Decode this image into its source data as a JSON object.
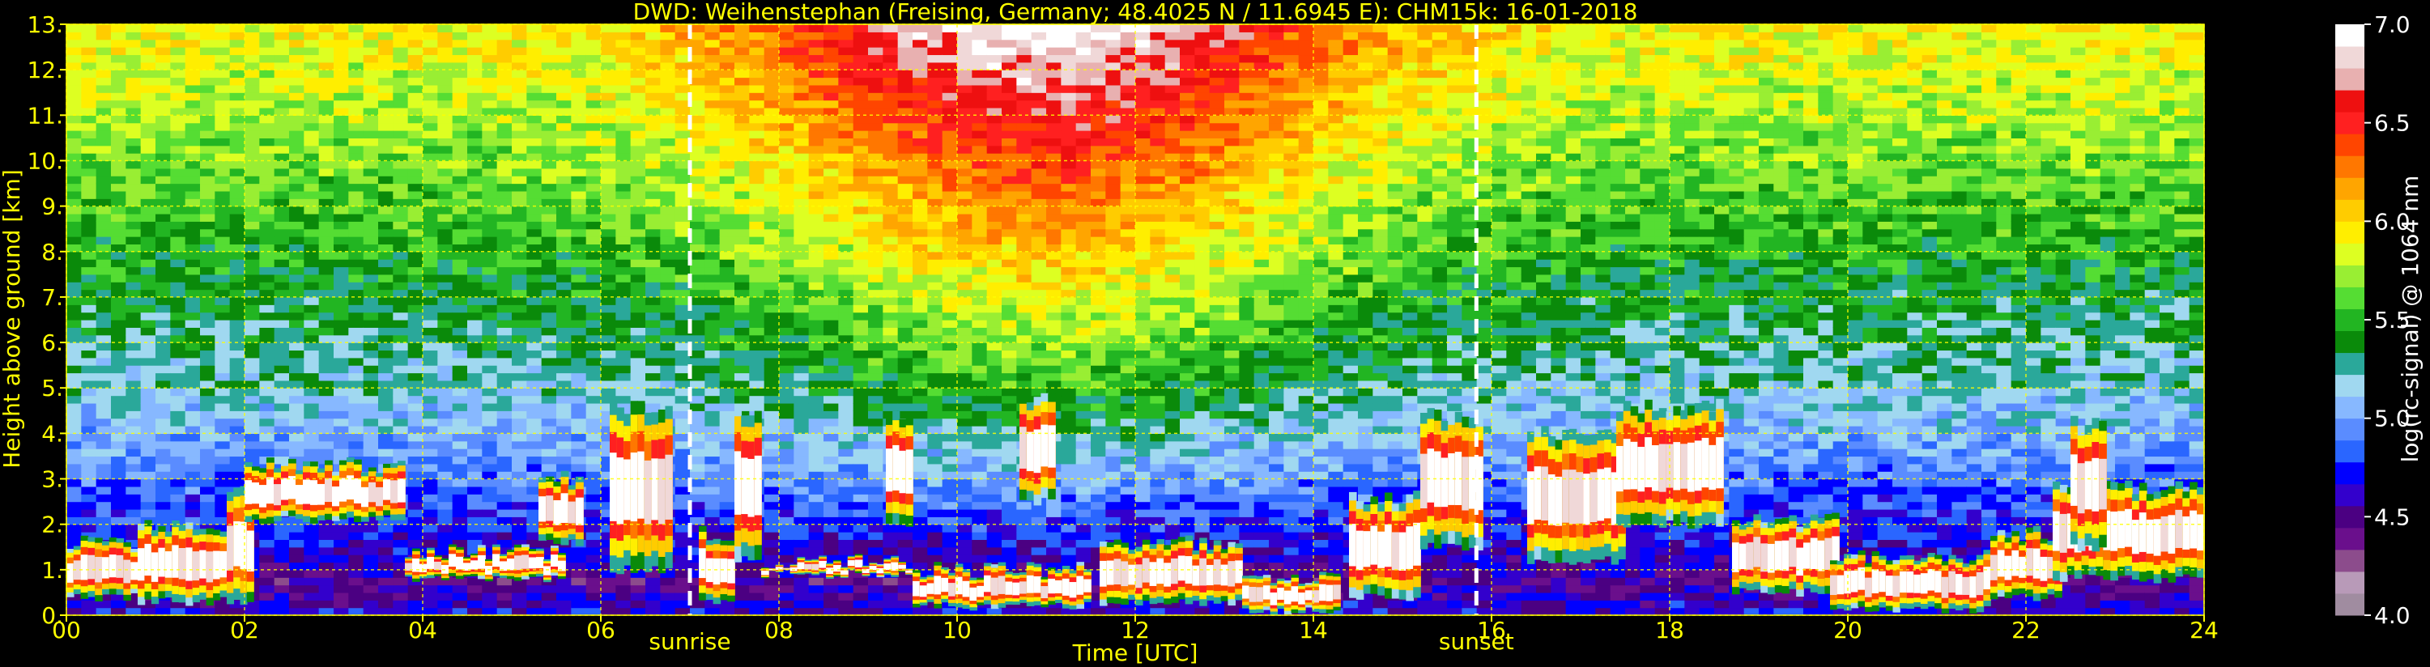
{
  "chart_data": {
    "type": "heatmap",
    "title": "DWD: Weihenstephan (Freising, Germany; 48.4025 N / 11.6945 E):    CHM15k: 16-01-2018",
    "xlabel": "Time [UTC]",
    "ylabel": "Height above ground [km]",
    "xlim": [
      0,
      24
    ],
    "ylim": [
      0,
      13
    ],
    "x_ticks": [
      0,
      2,
      4,
      6,
      8,
      10,
      12,
      14,
      16,
      18,
      20,
      22,
      24
    ],
    "x_tick_labels": [
      "00",
      "02",
      "04",
      "06",
      "08",
      "10",
      "12",
      "14",
      "16",
      "18",
      "20",
      "22",
      "24"
    ],
    "y_ticks": [
      0,
      1,
      2,
      3,
      4,
      5,
      6,
      7,
      8,
      9,
      10,
      11,
      12,
      13
    ],
    "y_tick_labels": [
      "0.",
      "1.",
      "2.",
      "3.",
      "4.",
      "5.",
      "6.",
      "7.",
      "8.",
      "9.",
      "10.",
      "11.",
      "12.",
      "13."
    ],
    "grid": true,
    "colorbar": {
      "label": "log(rc-signal) @ 1064 nm",
      "range": [
        4.0,
        7.0
      ],
      "ticks": [
        4.0,
        4.5,
        5.0,
        5.5,
        6.0,
        6.5,
        7.0
      ],
      "tick_labels": [
        "4.0",
        "4.5",
        "5.0",
        "5.5",
        "6.0",
        "6.5",
        "7.0"
      ],
      "colors": [
        "#a08ca0",
        "#b89ab8",
        "#8c4c8c",
        "#6a0f8c",
        "#4b0082",
        "#3300cc",
        "#0000ff",
        "#2a66ff",
        "#5a8cff",
        "#87b8ff",
        "#a0d8f0",
        "#2aa89a",
        "#0a8a0a",
        "#22b522",
        "#55dd33",
        "#99ee33",
        "#ddff22",
        "#ffee00",
        "#ffcc00",
        "#ffa500",
        "#ff7700",
        "#ff4500",
        "#ff2020",
        "#ee1010",
        "#e8b0b0",
        "#f0d8d8",
        "#ffffff"
      ]
    },
    "annotations": [
      {
        "label": "sunrise",
        "x": 7.0
      },
      {
        "label": "sunset",
        "x": 15.83
      }
    ],
    "cloud_events": [
      {
        "t0": 0.0,
        "t1": 0.8,
        "base": 0.4,
        "top": 1.6
      },
      {
        "t0": 0.8,
        "t1": 1.8,
        "base": 0.3,
        "top": 2.0
      },
      {
        "t0": 1.8,
        "t1": 2.1,
        "base": 0.3,
        "top": 2.7
      },
      {
        "t0": 2.0,
        "t1": 3.8,
        "base": 2.1,
        "top": 3.3
      },
      {
        "t0": 3.8,
        "t1": 5.6,
        "base": 0.8,
        "top": 1.4
      },
      {
        "t0": 5.3,
        "t1": 5.8,
        "base": 1.6,
        "top": 3.0
      },
      {
        "t0": 6.1,
        "t1": 6.8,
        "base": 1.0,
        "top": 4.6
      },
      {
        "t0": 7.1,
        "t1": 7.5,
        "base": 0.3,
        "top": 1.8
      },
      {
        "t0": 7.5,
        "t1": 7.8,
        "base": 1.2,
        "top": 4.5
      },
      {
        "t0": 7.8,
        "t1": 9.5,
        "base": 0.9,
        "top": 1.2
      },
      {
        "t0": 9.2,
        "t1": 9.5,
        "base": 2.0,
        "top": 4.4
      },
      {
        "t0": 9.5,
        "t1": 11.5,
        "base": 0.2,
        "top": 1.0
      },
      {
        "t0": 10.7,
        "t1": 11.1,
        "base": 2.5,
        "top": 4.8
      },
      {
        "t0": 11.6,
        "t1": 13.2,
        "base": 0.3,
        "top": 1.6
      },
      {
        "t0": 13.2,
        "t1": 14.3,
        "base": 0.1,
        "top": 0.8
      },
      {
        "t0": 14.4,
        "t1": 15.2,
        "base": 0.4,
        "top": 2.6
      },
      {
        "t0": 15.2,
        "t1": 15.9,
        "base": 1.5,
        "top": 4.4
      },
      {
        "t0": 16.4,
        "t1": 17.5,
        "base": 1.2,
        "top": 4.0
      },
      {
        "t0": 17.4,
        "t1": 18.6,
        "base": 2.0,
        "top": 4.6
      },
      {
        "t0": 18.7,
        "t1": 19.9,
        "base": 0.5,
        "top": 2.1
      },
      {
        "t0": 19.8,
        "t1": 21.6,
        "base": 0.1,
        "top": 1.3
      },
      {
        "t0": 21.6,
        "t1": 22.4,
        "base": 0.4,
        "top": 1.8
      },
      {
        "t0": 22.3,
        "t1": 24.0,
        "base": 0.8,
        "top": 2.8
      },
      {
        "t0": 22.5,
        "t1": 22.9,
        "base": 1.5,
        "top": 4.3
      }
    ]
  },
  "colors": {
    "background": "#000000",
    "title": "#ffff00",
    "tick_labels": "#ffff00",
    "grid": "#ffff00",
    "colorbar_text": "#ffffff",
    "marker_line": "#ffffff",
    "annotation_text": "#ffff00"
  }
}
